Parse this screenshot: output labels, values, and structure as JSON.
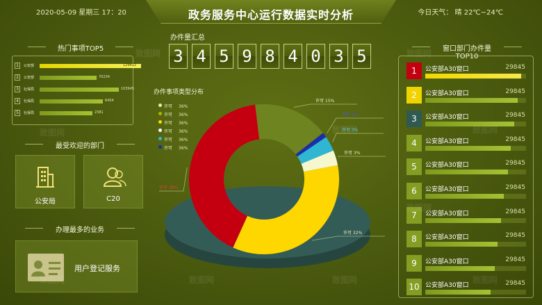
{
  "header": {
    "datetime": "2020-05-09  星期三 17：20",
    "title": "政务服务中心运行数据实时分析",
    "weather": "今日天气：  晴    22℃~24℃"
  },
  "top5": {
    "title": "热门事项TOP5",
    "items": [
      {
        "rank": "1",
        "label": "公安部",
        "value": "129422",
        "fraction": 1.0
      },
      {
        "rank": "2",
        "label": "公安部",
        "value": "70234",
        "fraction": 0.56
      },
      {
        "rank": "3",
        "label": "社保局",
        "value": "103945",
        "fraction": 0.78
      },
      {
        "rank": "4",
        "label": "社保局",
        "value": "6454",
        "fraction": 0.62
      },
      {
        "rank": "5",
        "label": "社保局",
        "value": "2381",
        "fraction": 0.52
      }
    ]
  },
  "departments": {
    "title": "最受欢迎的部门",
    "cards": [
      {
        "label": "公安局",
        "icon": "building-icon"
      },
      {
        "label": "C20",
        "icon": "users-icon"
      }
    ]
  },
  "business": {
    "title": "办理最多的业务",
    "label": "用户登记服务",
    "icon": "id-card-icon"
  },
  "counter": {
    "label": "办件量汇总",
    "digits": [
      "3",
      "4",
      "5",
      "9",
      "8",
      "4",
      "0",
      "3",
      "5"
    ]
  },
  "chart_data": {
    "type": "pie",
    "title": "办件事项类型分布",
    "legend": [
      {
        "label": "许可",
        "value": "36%",
        "color": "#e8ef9a"
      },
      {
        "label": "许可",
        "value": "36%",
        "color": "#a8b800"
      },
      {
        "label": "许可",
        "value": "36%",
        "color": "#ffd700"
      },
      {
        "label": "许可",
        "value": "36%",
        "color": "#ffffff"
      },
      {
        "label": "许可",
        "value": "36%",
        "color": "#2fb6d3"
      },
      {
        "label": "许可",
        "value": "36%",
        "color": "#1b2ea8"
      }
    ],
    "slices": [
      {
        "label": "许可",
        "value": 15,
        "display": "许可   15%",
        "color": "#6e8420"
      },
      {
        "label": "许可",
        "value": 1,
        "display": "许可   1%",
        "color": "#1b2ea8"
      },
      {
        "label": "许可",
        "value": 3,
        "display": "许可   3%",
        "color": "#2fb6d3"
      },
      {
        "label": "许可",
        "value": 3,
        "display": "许可   3%",
        "color": "#f5f7cf"
      },
      {
        "label": "许可",
        "value": 32,
        "display": "许可   32%",
        "color": "#ffd700"
      },
      {
        "label": "许可",
        "value": 38,
        "display": "许可   38%",
        "color": "#c40010"
      }
    ]
  },
  "window_top10": {
    "title": "窗口部门办件量TOP10",
    "items": [
      {
        "rank": "1",
        "name": "公安部A30窗口",
        "value": "29845",
        "color": "#c40010",
        "fraction": 0.95
      },
      {
        "rank": "2",
        "name": "公安部A30窗口",
        "value": "29845",
        "color": "#f0d400",
        "fraction": 0.92
      },
      {
        "rank": "3",
        "name": "公安部A30窗口",
        "value": "29845",
        "color": "#2f5a52",
        "fraction": 0.88
      },
      {
        "rank": "4",
        "name": "公安部A30窗口",
        "value": "29845",
        "color": "#839e22",
        "fraction": 0.85
      },
      {
        "rank": "5",
        "name": "公安部A30窗口",
        "value": "29845",
        "color": "#839e22",
        "fraction": 0.82
      },
      {
        "rank": "6",
        "name": "公安部A30窗口",
        "value": "29845",
        "color": "#839e22",
        "fraction": 0.78
      },
      {
        "rank": "7",
        "name": "公安部A30窗口",
        "value": "29845",
        "color": "#839e22",
        "fraction": 0.75
      },
      {
        "rank": "8",
        "name": "公安部A30窗口",
        "value": "29845",
        "color": "#839e22",
        "fraction": 0.72
      },
      {
        "rank": "9",
        "name": "公安部A30窗口",
        "value": "29845",
        "color": "#839e22",
        "fraction": 0.69
      },
      {
        "rank": "10",
        "name": "公安部A30窗口",
        "value": "29845",
        "color": "#839e22",
        "fraction": 0.65
      }
    ]
  }
}
